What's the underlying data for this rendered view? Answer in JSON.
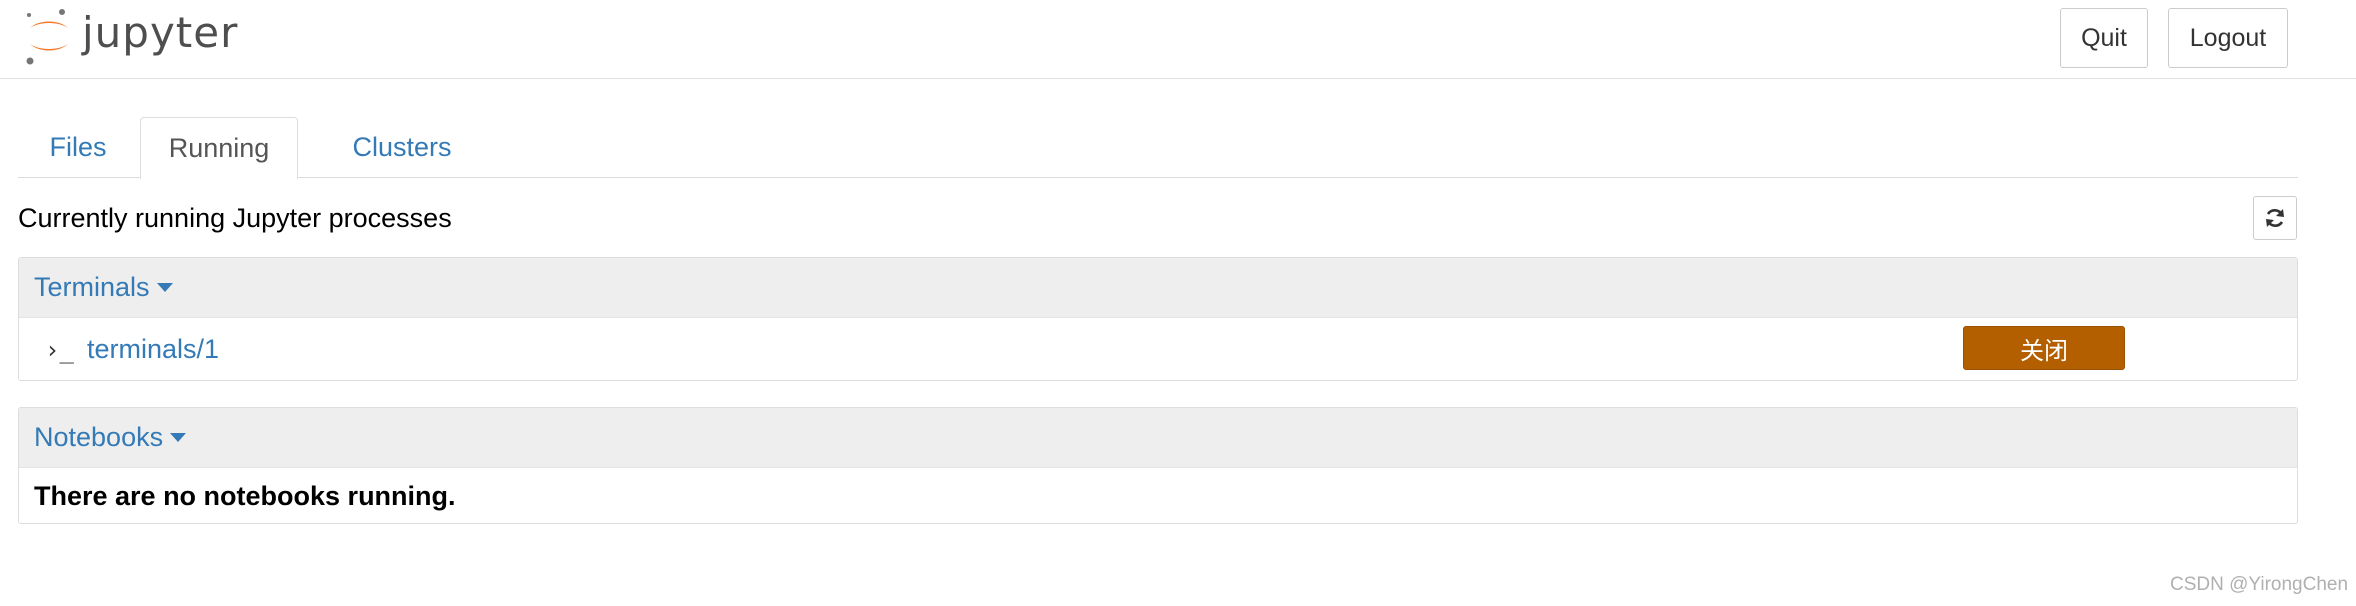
{
  "header": {
    "logo_text": "jupyter",
    "quit_label": "Quit",
    "logout_label": "Logout"
  },
  "tabs": [
    {
      "label": "Files",
      "active": false
    },
    {
      "label": "Running",
      "active": true
    },
    {
      "label": "Clusters",
      "active": false
    }
  ],
  "running": {
    "title": "Currently running Jupyter processes",
    "refresh_icon": "refresh-icon"
  },
  "terminals": {
    "heading": "Terminals",
    "items": [
      {
        "icon": "terminal-icon",
        "glyph": "›_",
        "name": "terminals/1",
        "shutdown_label": "关闭"
      }
    ]
  },
  "notebooks": {
    "heading": "Notebooks",
    "empty_message": "There are no notebooks running."
  },
  "watermark": "CSDN @YirongChen",
  "colors": {
    "link": "#337ab7",
    "shutdown_button": "#b35f00",
    "panel_heading_bg": "#eeeeee",
    "logo_orange": "#f37726"
  }
}
